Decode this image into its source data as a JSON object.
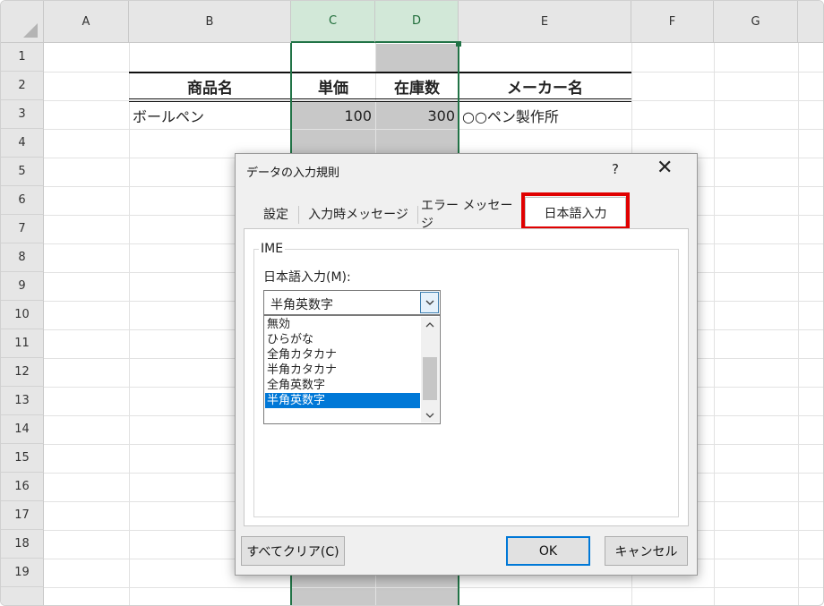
{
  "sheet": {
    "columns": [
      "A",
      "B",
      "C",
      "D",
      "E",
      "F",
      "G"
    ],
    "rows": [
      "1",
      "2",
      "3",
      "4",
      "5",
      "6",
      "7",
      "8",
      "9",
      "10",
      "11",
      "12",
      "13",
      "14",
      "15",
      "16",
      "17",
      "18",
      "19"
    ],
    "table": {
      "headers": {
        "b": "商品名",
        "c": "単価",
        "d": "在庫数",
        "e": "メーカー名"
      },
      "row3": {
        "b": "ボールペン",
        "c": "100",
        "d": "300",
        "e": "○○ペン製作所"
      }
    }
  },
  "dialog": {
    "title": "データの入力規則",
    "help": "?",
    "close": "✕",
    "tabs": [
      "設定",
      "入力時メッセージ",
      "エラー メッセージ",
      "日本語入力"
    ],
    "active_tab": "日本語入力",
    "group_label": "IME",
    "field_label": "日本語入力(M):",
    "select_value": "半角英数字",
    "options": [
      "無効",
      "ひらがな",
      "全角カタカナ",
      "半角カタカナ",
      "全角英数字",
      "半角英数字"
    ],
    "selected_option": "半角英数字",
    "clear_button": "すべてクリア(C)",
    "ok_button": "OK",
    "cancel_button": "キャンセル"
  },
  "colors": {
    "excel_green": "#217346",
    "highlight_red": "#e00000",
    "selection_blue": "#0078d7"
  },
  "icons": {
    "dropdown": "chevron-down-icon",
    "scroll_up": "chevron-up-icon",
    "scroll_down": "chevron-down-icon",
    "close": "close-icon",
    "help": "help-icon"
  }
}
